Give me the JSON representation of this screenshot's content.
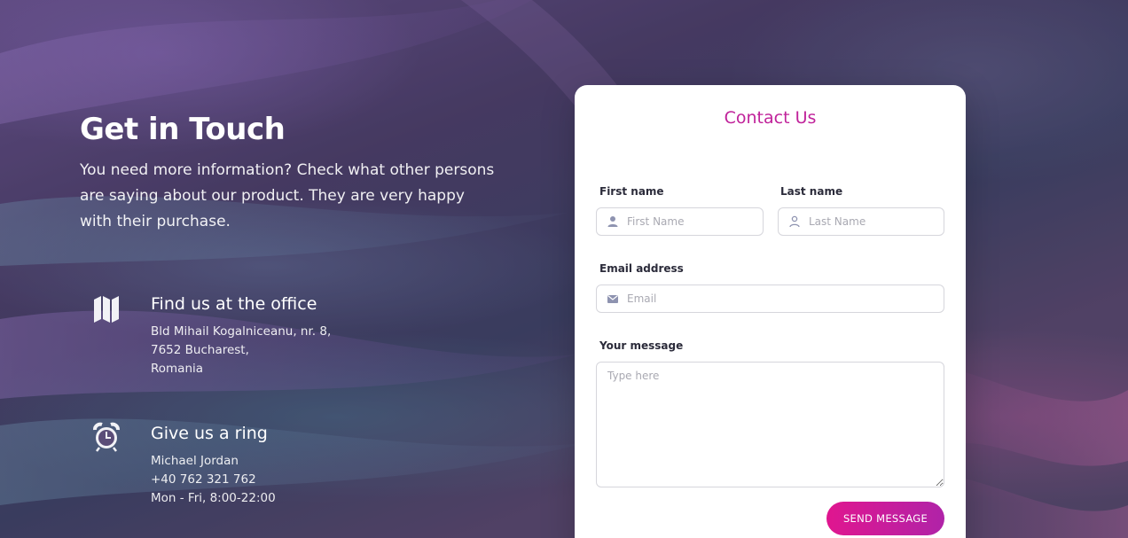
{
  "hero": {
    "title": "Get in Touch",
    "lead": "You need more information? Check what other persons are saying about our product. They are very happy with their purchase."
  },
  "office": {
    "icon": "map-icon",
    "heading": "Find us at the office",
    "line1": "Bld Mihail Kogalniceanu, nr. 8,",
    "line2": "7652 Bucharest,",
    "line3": "Romania"
  },
  "ring": {
    "icon": "alarm-clock-icon",
    "heading": "Give us a ring",
    "line1": "Michael Jordan",
    "line2": "+40 762 321 762",
    "line3": "Mon - Fri, 8:00-22:00"
  },
  "form": {
    "title": "Contact Us",
    "first_name_label": "First name",
    "first_name_placeholder": "First Name",
    "last_name_label": "Last name",
    "last_name_placeholder": "Last Name",
    "email_label": "Email address",
    "email_placeholder": "Email",
    "message_label": "Your message",
    "message_placeholder": "Type here",
    "send_label": "SEND MESSAGE"
  },
  "colors": {
    "accent": "#c0229a",
    "button_start": "#e0168f",
    "button_end": "#b023a8"
  }
}
